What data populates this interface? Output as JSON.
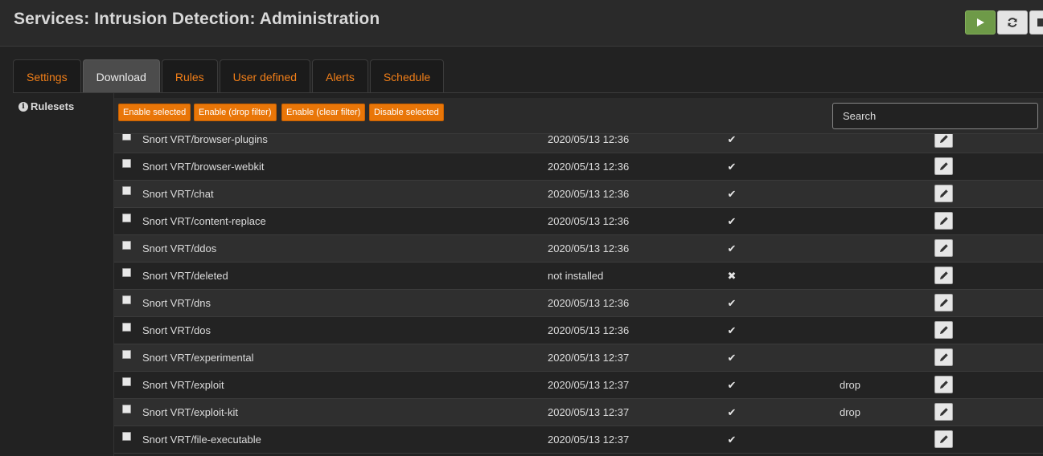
{
  "page": {
    "title": "Services: Intrusion Detection: Administration"
  },
  "header_buttons": {
    "play_icon": "play-icon",
    "reload_icon": "reload-icon",
    "stop_icon": "stop-icon",
    "play_color": "#6e9a48"
  },
  "tabs": [
    {
      "label": "Settings",
      "active": false
    },
    {
      "label": "Download",
      "active": true
    },
    {
      "label": "Rules",
      "active": false
    },
    {
      "label": "User defined",
      "active": false
    },
    {
      "label": "Alerts",
      "active": false
    },
    {
      "label": "Schedule",
      "active": false
    }
  ],
  "section": {
    "label": "Rulesets",
    "icon": "info-icon"
  },
  "toolbar": {
    "enable_selected": "Enable selected",
    "enable_drop_filter": "Enable (drop filter)",
    "enable_clear_filter": "Enable (clear filter)",
    "disable_selected": "Disable selected",
    "search_placeholder": "Search",
    "accent_color": "#e97608"
  },
  "rulesets": [
    {
      "name": "Snort VRT/browser-plugins",
      "date": "2020/05/13 12:36",
      "installed": true,
      "action": ""
    },
    {
      "name": "Snort VRT/browser-webkit",
      "date": "2020/05/13 12:36",
      "installed": true,
      "action": ""
    },
    {
      "name": "Snort VRT/chat",
      "date": "2020/05/13 12:36",
      "installed": true,
      "action": ""
    },
    {
      "name": "Snort VRT/content-replace",
      "date": "2020/05/13 12:36",
      "installed": true,
      "action": ""
    },
    {
      "name": "Snort VRT/ddos",
      "date": "2020/05/13 12:36",
      "installed": true,
      "action": ""
    },
    {
      "name": "Snort VRT/deleted",
      "date": "not installed",
      "installed": false,
      "action": ""
    },
    {
      "name": "Snort VRT/dns",
      "date": "2020/05/13 12:36",
      "installed": true,
      "action": ""
    },
    {
      "name": "Snort VRT/dos",
      "date": "2020/05/13 12:36",
      "installed": true,
      "action": ""
    },
    {
      "name": "Snort VRT/experimental",
      "date": "2020/05/13 12:37",
      "installed": true,
      "action": ""
    },
    {
      "name": "Snort VRT/exploit",
      "date": "2020/05/13 12:37",
      "installed": true,
      "action": "drop"
    },
    {
      "name": "Snort VRT/exploit-kit",
      "date": "2020/05/13 12:37",
      "installed": true,
      "action": "drop"
    },
    {
      "name": "Snort VRT/file-executable",
      "date": "2020/05/13 12:37",
      "installed": true,
      "action": ""
    }
  ],
  "glyphs": {
    "check": "✔",
    "cross": "✖"
  }
}
